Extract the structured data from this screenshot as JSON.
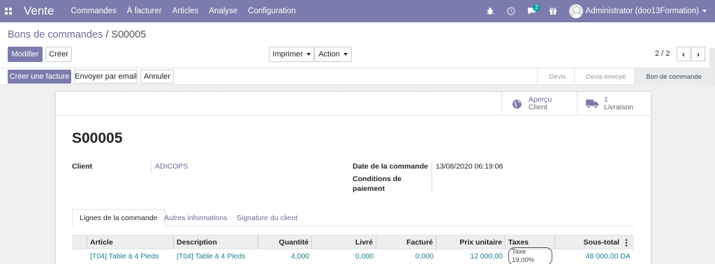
{
  "navbar": {
    "brand": "Vente",
    "menu": [
      "Commandes",
      "À facturer",
      "Articles",
      "Analyse",
      "Configuration"
    ],
    "messages_badge": "2",
    "user": "Administrator (doo13Formation)",
    "color": "#7c7bad"
  },
  "breadcrumb": {
    "parent": "Bons de commandes",
    "separator": " / ",
    "current": "S00005"
  },
  "buttons": {
    "edit": "Modifier",
    "create": "Créer",
    "print": "Imprimer",
    "action": "Action",
    "pager": "2 / 2"
  },
  "statusbar": {
    "create_invoice": "Créer une facture",
    "send_email": "Envoyer par email",
    "cancel": "Annuler",
    "stages": [
      "Devis",
      "Devis envoyé",
      "Bon de commande"
    ],
    "active_stage": "Bon de commande"
  },
  "smart_buttons": {
    "preview_top": "Aperçu",
    "preview_bottom": "Client",
    "delivery_count": "1",
    "delivery_label": "Livraison"
  },
  "record": {
    "name": "S00005",
    "client_label": "Client",
    "client_value": "ADICOPS",
    "date_label": "Date de la commande",
    "date_value": "13/08/2020 06:19:08",
    "terms_label_1": "Conditions de",
    "terms_label_2": "paiement"
  },
  "tabs": [
    "Lignes de la commande",
    "Autres informations",
    "Signature du client"
  ],
  "table": {
    "headers": [
      "Article",
      "Description",
      "Quantité",
      "Livré",
      "Facturé",
      "Prix unitaire",
      "Taxes",
      "Sous-total"
    ],
    "rows": [
      {
        "article": "[T04] Table à 4 Pieds",
        "description": "[T04] Table à 4 Pieds",
        "quantity": "4,000",
        "delivered": "0,000",
        "invoiced": "0,000",
        "unit_price": "12 000,00",
        "tax": "Taxe 19,00%",
        "subtotal": "48 000,00 DA"
      }
    ]
  }
}
